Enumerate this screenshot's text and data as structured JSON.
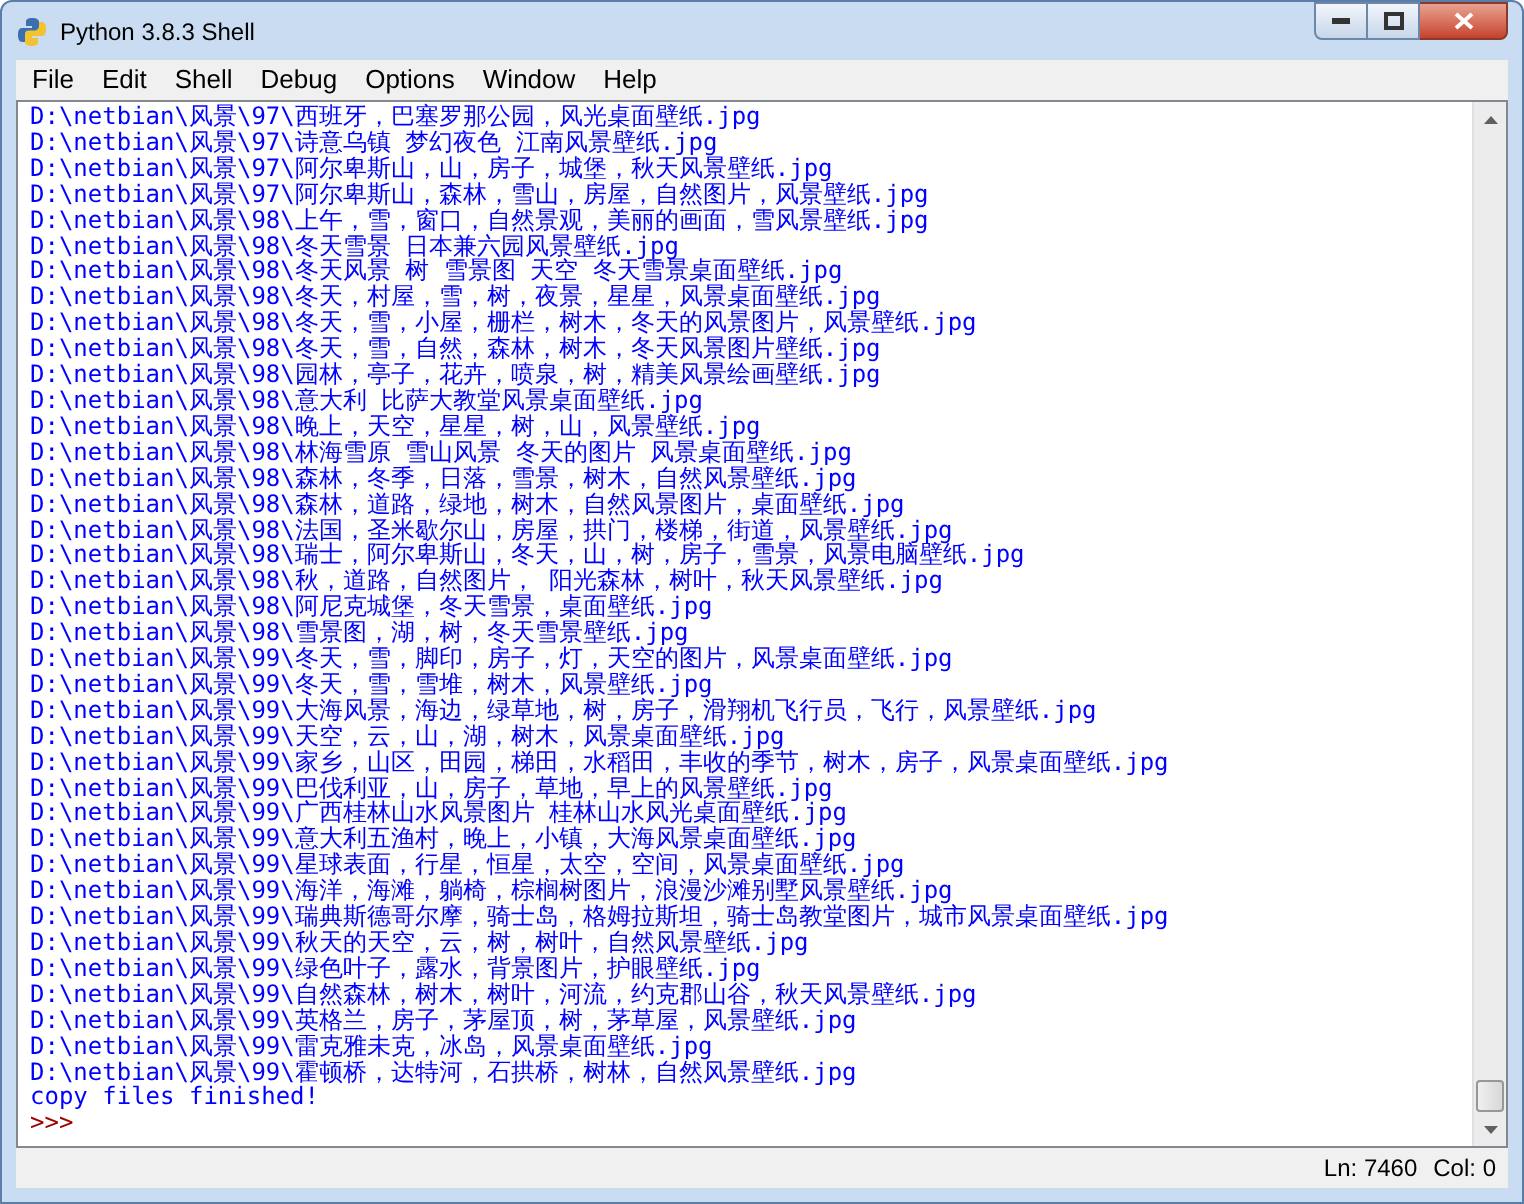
{
  "window": {
    "title": "Python 3.8.3 Shell"
  },
  "menu": [
    "File",
    "Edit",
    "Shell",
    "Debug",
    "Options",
    "Window",
    "Help"
  ],
  "lines": [
    {
      "kind": "output",
      "text": "D:\\netbian\\风景\\97\\西班牙，巴塞罗那公园，风光桌面壁纸.jpg"
    },
    {
      "kind": "output",
      "text": "D:\\netbian\\风景\\97\\诗意乌镇 梦幻夜色 江南风景壁纸.jpg"
    },
    {
      "kind": "output",
      "text": "D:\\netbian\\风景\\97\\阿尔卑斯山，山，房子，城堡，秋天风景壁纸.jpg"
    },
    {
      "kind": "output",
      "text": "D:\\netbian\\风景\\97\\阿尔卑斯山，森林，雪山，房屋，自然图片，风景壁纸.jpg"
    },
    {
      "kind": "output",
      "text": "D:\\netbian\\风景\\98\\上午，雪，窗口，自然景观，美丽的画面，雪风景壁纸.jpg"
    },
    {
      "kind": "output",
      "text": "D:\\netbian\\风景\\98\\冬天雪景 日本兼六园风景壁纸.jpg"
    },
    {
      "kind": "output",
      "text": "D:\\netbian\\风景\\98\\冬天风景 树 雪景图 天空 冬天雪景桌面壁纸.jpg"
    },
    {
      "kind": "output",
      "text": "D:\\netbian\\风景\\98\\冬天，村屋，雪，树，夜景，星星，风景桌面壁纸.jpg"
    },
    {
      "kind": "output",
      "text": "D:\\netbian\\风景\\98\\冬天，雪，小屋，栅栏，树木，冬天的风景图片，风景壁纸.jpg"
    },
    {
      "kind": "output",
      "text": "D:\\netbian\\风景\\98\\冬天，雪，自然，森林，树木，冬天风景图片壁纸.jpg"
    },
    {
      "kind": "output",
      "text": "D:\\netbian\\风景\\98\\园林，亭子，花卉，喷泉，树，精美风景绘画壁纸.jpg"
    },
    {
      "kind": "output",
      "text": "D:\\netbian\\风景\\98\\意大利 比萨大教堂风景桌面壁纸.jpg"
    },
    {
      "kind": "output",
      "text": "D:\\netbian\\风景\\98\\晚上，天空，星星，树，山，风景壁纸.jpg"
    },
    {
      "kind": "output",
      "text": "D:\\netbian\\风景\\98\\林海雪原 雪山风景 冬天的图片 风景桌面壁纸.jpg"
    },
    {
      "kind": "output",
      "text": "D:\\netbian\\风景\\98\\森林，冬季，日落，雪景，树木，自然风景壁纸.jpg"
    },
    {
      "kind": "output",
      "text": "D:\\netbian\\风景\\98\\森林，道路，绿地，树木，自然风景图片，桌面壁纸.jpg"
    },
    {
      "kind": "output",
      "text": "D:\\netbian\\风景\\98\\法国，圣米歇尔山，房屋，拱门，楼梯，街道，风景壁纸.jpg"
    },
    {
      "kind": "output",
      "text": "D:\\netbian\\风景\\98\\瑞士，阿尔卑斯山，冬天，山，树，房子，雪景，风景电脑壁纸.jpg"
    },
    {
      "kind": "output",
      "text": "D:\\netbian\\风景\\98\\秋，道路，自然图片， 阳光森林，树叶，秋天风景壁纸.jpg"
    },
    {
      "kind": "output",
      "text": "D:\\netbian\\风景\\98\\阿尼克城堡，冬天雪景，桌面壁纸.jpg"
    },
    {
      "kind": "output",
      "text": "D:\\netbian\\风景\\98\\雪景图，湖，树，冬天雪景壁纸.jpg"
    },
    {
      "kind": "output",
      "text": "D:\\netbian\\风景\\99\\冬天，雪，脚印，房子，灯，天空的图片，风景桌面壁纸.jpg"
    },
    {
      "kind": "output",
      "text": "D:\\netbian\\风景\\99\\冬天，雪，雪堆，树木，风景壁纸.jpg"
    },
    {
      "kind": "output",
      "text": "D:\\netbian\\风景\\99\\大海风景，海边，绿草地，树，房子，滑翔机飞行员，飞行，风景壁纸.jpg"
    },
    {
      "kind": "output",
      "text": "D:\\netbian\\风景\\99\\天空，云，山，湖，树木，风景桌面壁纸.jpg"
    },
    {
      "kind": "output",
      "text": "D:\\netbian\\风景\\99\\家乡，山区，田园，梯田，水稻田，丰收的季节，树木，房子，风景桌面壁纸.jpg"
    },
    {
      "kind": "output",
      "text": "D:\\netbian\\风景\\99\\巴伐利亚，山，房子，草地，早上的风景壁纸.jpg"
    },
    {
      "kind": "output",
      "text": "D:\\netbian\\风景\\99\\广西桂林山水风景图片 桂林山水风光桌面壁纸.jpg"
    },
    {
      "kind": "output",
      "text": "D:\\netbian\\风景\\99\\意大利五渔村，晚上，小镇，大海风景桌面壁纸.jpg"
    },
    {
      "kind": "output",
      "text": "D:\\netbian\\风景\\99\\星球表面，行星，恒星，太空，空间，风景桌面壁纸.jpg"
    },
    {
      "kind": "output",
      "text": "D:\\netbian\\风景\\99\\海洋，海滩，躺椅，棕榈树图片，浪漫沙滩别墅风景壁纸.jpg"
    },
    {
      "kind": "output",
      "text": "D:\\netbian\\风景\\99\\瑞典斯德哥尔摩，骑士岛，格姆拉斯坦，骑士岛教堂图片，城市风景桌面壁纸.jpg"
    },
    {
      "kind": "output",
      "text": "D:\\netbian\\风景\\99\\秋天的天空，云，树，树叶，自然风景壁纸.jpg"
    },
    {
      "kind": "output",
      "text": "D:\\netbian\\风景\\99\\绿色叶子，露水，背景图片，护眼壁纸.jpg"
    },
    {
      "kind": "output",
      "text": "D:\\netbian\\风景\\99\\自然森林，树木，树叶，河流，约克郡山谷，秋天风景壁纸.jpg"
    },
    {
      "kind": "output",
      "text": "D:\\netbian\\风景\\99\\英格兰，房子，茅屋顶，树，茅草屋，风景壁纸.jpg"
    },
    {
      "kind": "output",
      "text": "D:\\netbian\\风景\\99\\雷克雅未克，冰岛，风景桌面壁纸.jpg"
    },
    {
      "kind": "output",
      "text": "D:\\netbian\\风景\\99\\霍顿桥，达特河，石拱桥，树林，自然风景壁纸.jpg"
    },
    {
      "kind": "output",
      "text": "copy files finished!"
    },
    {
      "kind": "prompt",
      "text": ">>>"
    }
  ],
  "status_bar": {
    "line": "Ln: 7460",
    "column": "Col: 0"
  }
}
